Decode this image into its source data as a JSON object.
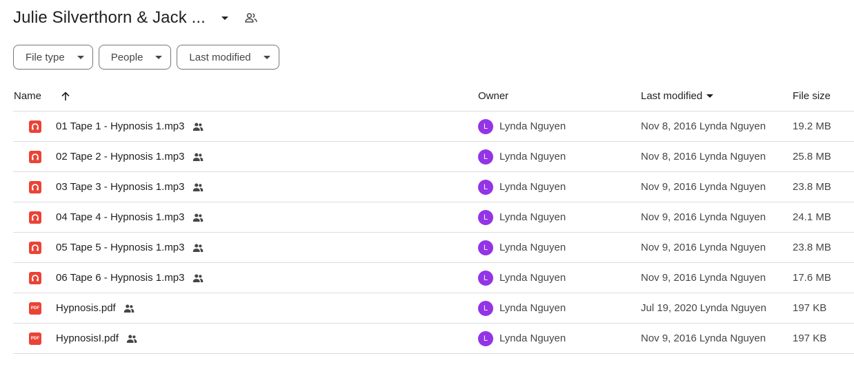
{
  "folder": {
    "title": "Julie Silverthorn & Jack ...",
    "caret_icon": "arrow-drop-down-icon",
    "shared_icon": "shared-folder-people-icon"
  },
  "filters": [
    {
      "label": "File type"
    },
    {
      "label": "People"
    },
    {
      "label": "Last modified"
    }
  ],
  "columns": {
    "name": "Name",
    "owner": "Owner",
    "last_modified": "Last modified",
    "file_size": "File size",
    "sort_icon": "arrow-upward-icon"
  },
  "colors": {
    "file_icon": "#ea4335",
    "avatar": "#9334e6",
    "divider": "#dadce0"
  },
  "files": [
    {
      "type": "audio",
      "name": "01 Tape 1 - Hypnosis 1.mp3",
      "owner_initial": "L",
      "owner": "Lynda Nguyen",
      "date": "Nov 8, 2016",
      "modified_by": "Lynda Nguyen",
      "size": "19.2 MB"
    },
    {
      "type": "audio",
      "name": "02 Tape 2 - Hypnosis 1.mp3",
      "owner_initial": "L",
      "owner": "Lynda Nguyen",
      "date": "Nov 8, 2016",
      "modified_by": "Lynda Nguyen",
      "size": "25.8 MB"
    },
    {
      "type": "audio",
      "name": "03 Tape 3 - Hypnosis 1.mp3",
      "owner_initial": "L",
      "owner": "Lynda Nguyen",
      "date": "Nov 9, 2016",
      "modified_by": "Lynda Nguyen",
      "size": "23.8 MB"
    },
    {
      "type": "audio",
      "name": "04 Tape 4 - Hypnosis 1.mp3",
      "owner_initial": "L",
      "owner": "Lynda Nguyen",
      "date": "Nov 9, 2016",
      "modified_by": "Lynda Nguyen",
      "size": "24.1 MB"
    },
    {
      "type": "audio",
      "name": "05 Tape 5 - Hypnosis 1.mp3",
      "owner_initial": "L",
      "owner": "Lynda Nguyen",
      "date": "Nov 9, 2016",
      "modified_by": "Lynda Nguyen",
      "size": "23.8 MB"
    },
    {
      "type": "audio",
      "name": "06 Tape 6 - Hypnosis 1.mp3",
      "owner_initial": "L",
      "owner": "Lynda Nguyen",
      "date": "Nov 9, 2016",
      "modified_by": "Lynda Nguyen",
      "size": "17.6 MB"
    },
    {
      "type": "pdf",
      "pdf_label": "PDF",
      "name": "Hypnosis.pdf",
      "owner_initial": "L",
      "owner": "Lynda Nguyen",
      "date": "Jul 19, 2020",
      "modified_by": "Lynda Nguyen",
      "size": "197 KB"
    },
    {
      "type": "pdf",
      "pdf_label": "PDF",
      "name": "HypnosisI.pdf",
      "owner_initial": "L",
      "owner": "Lynda Nguyen",
      "date": "Nov 9, 2016",
      "modified_by": "Lynda Nguyen",
      "size": "197 KB"
    }
  ]
}
